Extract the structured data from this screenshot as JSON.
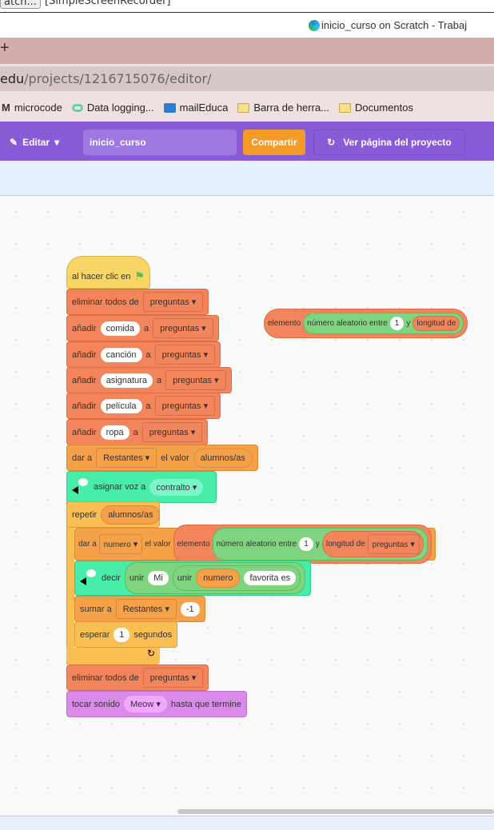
{
  "taskbar": {
    "tab1": "atch...",
    "tab2": "[SimpleScreenRecorder]"
  },
  "window_title": "inicio_curso on Scratch - Trabaj",
  "tabbar": {
    "new_tab": "+"
  },
  "url": {
    "host": "edu",
    "path": "/projects/1216715076/editor/"
  },
  "bookmarks": [
    {
      "label": "microcode",
      "icon": "microcode-icon"
    },
    {
      "label": "Data logging...",
      "icon": "data-logging-icon"
    },
    {
      "label": "mailEduca",
      "icon": "mail-icon"
    },
    {
      "label": "Barra de herra...",
      "icon": "folder-icon"
    },
    {
      "label": "Documentos",
      "icon": "folder-icon"
    }
  ],
  "menubar": {
    "edit": "Editar",
    "title": "inicio_curso",
    "share": "Compartir",
    "project_page": "Ver página del proyecto"
  },
  "colors": {
    "menubar": "#8a5bd6",
    "share": "#f49a27",
    "data": "#f2855b",
    "variables": "#f5a14a",
    "events": "#f8d666",
    "control": "#f9bf52",
    "tts": "#47eda9",
    "operators": "#7fd57f",
    "sound": "#da8be9"
  },
  "script": {
    "hat": "al hacer clic en",
    "clear": {
      "label": "eliminar todos de",
      "list": "preguntas"
    },
    "add": {
      "label": "añadir",
      "to": "a",
      "list": "preguntas",
      "items": [
        "comida",
        "canción",
        "asignatura",
        "película",
        "ropa"
      ]
    },
    "set1": {
      "label": "dar a",
      "var": "Restantes",
      "value_label": "el valor",
      "value": "alumnos/as"
    },
    "voice": {
      "label": "asignar voz a",
      "value": "contralto"
    },
    "repeat": {
      "label": "repetir",
      "value": "alumnos/as"
    },
    "set2": {
      "label": "dar a",
      "var": "numero",
      "value_label": "el valor",
      "item": "elemento",
      "random": "número aleatorio entre",
      "from": "1",
      "and": "y",
      "length": "longitud de",
      "list": "preguntas"
    },
    "say": {
      "label": "decir",
      "join": "unir",
      "a": "Mi",
      "join2": "unir",
      "var": "numero",
      "b": "favorita es"
    },
    "change": {
      "label": "sumar a",
      "var": "Restantes",
      "value": "-1"
    },
    "wait": {
      "label": "esperar",
      "value": "1",
      "unit": "segundos"
    },
    "clear2": {
      "label": "eliminar todos de",
      "list": "preguntas"
    },
    "sound": {
      "label": "tocar sonido",
      "value": "Meow",
      "suffix": "hasta que termine"
    }
  },
  "loose": {
    "item": "elemento",
    "random": "número aleatorio entre",
    "from": "1",
    "and": "y",
    "length": "longitud de"
  }
}
